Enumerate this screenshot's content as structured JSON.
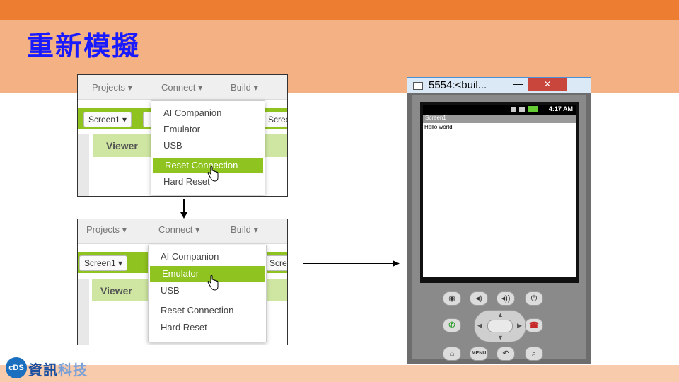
{
  "slide": {
    "title": "重新模擬"
  },
  "panel_top": {
    "menu": [
      "Projects ▾",
      "Connect ▾",
      "Build ▾"
    ],
    "screen_button": "Screen1 ▾",
    "screen_partial": "Scree",
    "viewer_label": "Viewer",
    "dropdown": [
      "AI Companion",
      "Emulator",
      "USB",
      "Reset Connection",
      "Hard Reset"
    ],
    "selected": "Reset Connection"
  },
  "panel_bottom": {
    "menu": [
      "Projects ▾",
      "Connect ▾",
      "Build ▾"
    ],
    "screen_button": "Screen1 ▾",
    "screen_partial": "Scre",
    "viewer_label": "Viewer",
    "dropdown": [
      "AI Companion",
      "Emulator",
      "USB",
      "Reset Connection",
      "Hard Reset"
    ],
    "selected": "Emulator"
  },
  "emulator": {
    "window_title": "5554:<buil...",
    "minimize": "—",
    "close": "✕",
    "status_time": "4:17 AM",
    "app_title": "Screen1",
    "app_text": "Hello world",
    "buttons": {
      "camera": "◉",
      "vol_down": "◂)",
      "vol_up": "◂))",
      "power": "⏻",
      "call": "✆",
      "end": "☎",
      "home": "⌂",
      "menu": "MENU",
      "back": "↶",
      "search": "⌕"
    }
  },
  "logo": {
    "badge": "cDS",
    "text_main": "資訊",
    "text_accent": "科技"
  },
  "colors": {
    "accent_orange": "#ed7d31",
    "title_band": "#f4b183",
    "title_text": "#1a1aff",
    "app_inventor_green": "#8fc31f"
  }
}
